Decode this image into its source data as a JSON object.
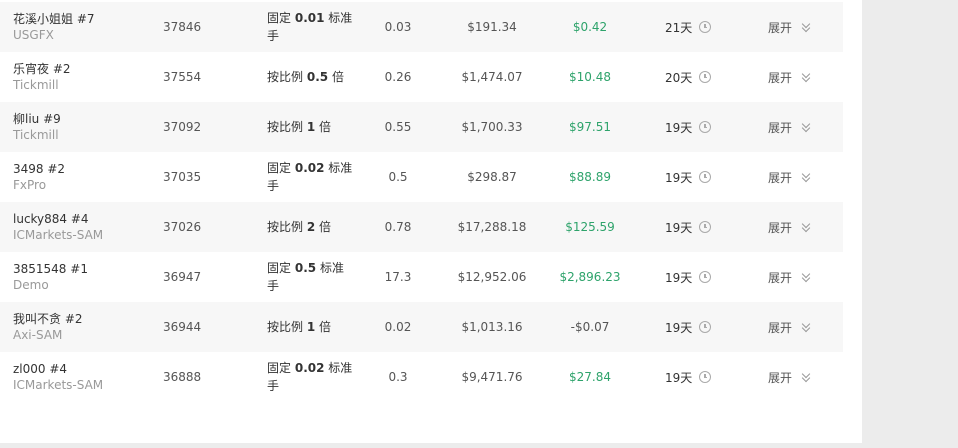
{
  "colors": {
    "profit": "#2ea36b",
    "alt_row": "#f7f7f7",
    "background": "#ececec"
  },
  "rows": [
    {
      "name": "花溪小姐姐 #7",
      "broker": "USGFX",
      "id": "37846",
      "mode_pre": "固定",
      "mode_val": "0.01",
      "mode_post": "标准手",
      "lots": "0.03",
      "equity": "$191.34",
      "pnl": "$0.42",
      "pnl_positive": true,
      "days": "21天",
      "expand": "展开"
    },
    {
      "name": "乐宵夜 #2",
      "broker": "Tickmill",
      "id": "37554",
      "mode_pre": "按比例",
      "mode_val": "0.5",
      "mode_post": "倍",
      "lots": "0.26",
      "equity": "$1,474.07",
      "pnl": "$10.48",
      "pnl_positive": true,
      "days": "20天",
      "expand": "展开"
    },
    {
      "name": "柳liu #9",
      "broker": "Tickmill",
      "id": "37092",
      "mode_pre": "按比例",
      "mode_val": "1",
      "mode_post": "倍",
      "lots": "0.55",
      "equity": "$1,700.33",
      "pnl": "$97.51",
      "pnl_positive": true,
      "days": "19天",
      "expand": "展开"
    },
    {
      "name": "3498 #2",
      "broker": "FxPro",
      "id": "37035",
      "mode_pre": "固定",
      "mode_val": "0.02",
      "mode_post": "标准手",
      "lots": "0.5",
      "equity": "$298.87",
      "pnl": "$88.89",
      "pnl_positive": true,
      "days": "19天",
      "expand": "展开"
    },
    {
      "name": "lucky884 #4",
      "broker": "ICMarkets-SAM",
      "id": "37026",
      "mode_pre": "按比例",
      "mode_val": "2",
      "mode_post": "倍",
      "lots": "0.78",
      "equity": "$17,288.18",
      "pnl": "$125.59",
      "pnl_positive": true,
      "days": "19天",
      "expand": "展开"
    },
    {
      "name": "3851548 #1",
      "broker": "Demo",
      "id": "36947",
      "mode_pre": "固定",
      "mode_val": "0.5",
      "mode_post": "标准手",
      "lots": "17.3",
      "equity": "$12,952.06",
      "pnl": "$2,896.23",
      "pnl_positive": true,
      "days": "19天",
      "expand": "展开"
    },
    {
      "name": "我叫不贪 #2",
      "broker": "Axi-SAM",
      "id": "36944",
      "mode_pre": "按比例",
      "mode_val": "1",
      "mode_post": "倍",
      "lots": "0.02",
      "equity": "$1,013.16",
      "pnl": "-$0.07",
      "pnl_positive": false,
      "days": "19天",
      "expand": "展开"
    },
    {
      "name": "zl000 #4",
      "broker": "ICMarkets-SAM",
      "id": "36888",
      "mode_pre": "固定",
      "mode_val": "0.02",
      "mode_post": "标准手",
      "lots": "0.3",
      "equity": "$9,471.76",
      "pnl": "$27.84",
      "pnl_positive": true,
      "days": "19天",
      "expand": "展开"
    }
  ]
}
